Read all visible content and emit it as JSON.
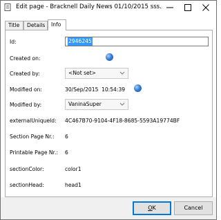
{
  "window": {
    "title": "Edit page - Bracknell Daily News 01/10/2015 sss...",
    "minimize_label": "—",
    "maximize_label": "☐",
    "close_label": "✕"
  },
  "tabs": [
    {
      "label": "Title",
      "active": false
    },
    {
      "label": "Details",
      "active": false
    },
    {
      "label": "Info",
      "active": true
    }
  ],
  "info": {
    "id": {
      "label": "Id:",
      "value": "2946245"
    },
    "created_on": {
      "label": "Created on:"
    },
    "created_by": {
      "label": "Created by:",
      "value": "<Not set>"
    },
    "modified_on": {
      "label": "Modified on:",
      "date": "30/Sep/2015",
      "time": "10:54:39"
    },
    "modified_by": {
      "label": "Modified by:",
      "value": "VaninaSuper"
    },
    "external_unique_id": {
      "label": "externalUniqueId:",
      "value": "4C467B70-9104-4F18-8685-5593A19774BF"
    },
    "section_page_nr": {
      "label": "Section Page Nr.:",
      "value": "6"
    },
    "printable_page_nr": {
      "label": "Printable Page Nr.:",
      "value": "6"
    },
    "section_color": {
      "label": "sectionColor:",
      "value": "color1"
    },
    "section_head": {
      "label": "sectionHead:",
      "value": "head1"
    }
  },
  "buttons": {
    "ok_mnemonic": "O",
    "ok_rest": "K",
    "cancel_label": "Cancel"
  },
  "colors": {
    "selection": "#3399ff",
    "globe": "#3a7fd6",
    "default_button_border": "#0078d7"
  },
  "icons": [
    "app-icon",
    "minimize-icon",
    "maximize-icon",
    "close-icon",
    "globe-icon",
    "chevron-down-icon"
  ]
}
